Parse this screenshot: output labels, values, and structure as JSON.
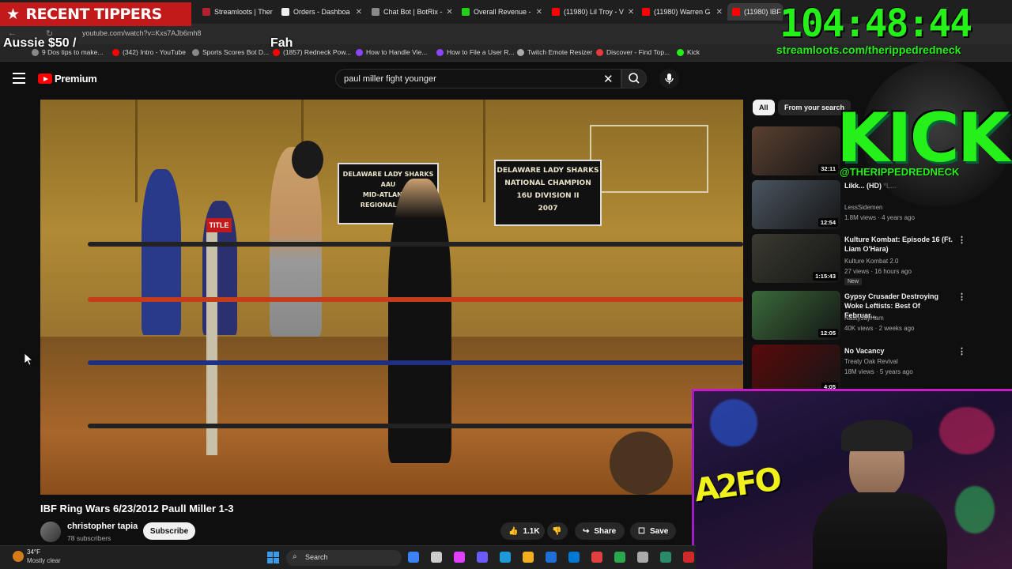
{
  "browser": {
    "tabs": [
      {
        "label": "RECENT TIPPERS",
        "fav": "#c21a1a"
      },
      {
        "label": "Streamloots | Ther",
        "fav": "#b32030"
      },
      {
        "label": "Orders - Dashboa",
        "fav": "#eeeeee"
      },
      {
        "label": "Chat Bot | BotRix -",
        "fav": "#8a8a8a"
      },
      {
        "label": "Overall Revenue -",
        "fav": "#25d01b"
      },
      {
        "label": "(11980) Lil Troy - V",
        "fav": "#ff0000"
      },
      {
        "label": "(11980) Warren G",
        "fav": "#ff0000"
      },
      {
        "label": "(11980) IBF R",
        "fav": "#ff0000"
      }
    ],
    "url": "youtube.com/watch?v=Kxs7AJb6mh8",
    "bookmarks": [
      {
        "label": "9 Dos tips to make...",
        "color": "#888888"
      },
      {
        "label": "(342) Intro - YouTube",
        "color": "#ff0000"
      },
      {
        "label": "Sports Scores Bot D...",
        "color": "#888888"
      },
      {
        "label": "(1857) Redneck Pow...",
        "color": "#ff0000"
      },
      {
        "label": "How to Handle Vie...",
        "color": "#8b44ff"
      },
      {
        "label": "How to File a User R...",
        "color": "#8b44ff"
      },
      {
        "label": "Twitch Emote Resizer",
        "color": "#aaaaaa"
      },
      {
        "label": "Discover - Find Top...",
        "color": "#e83a3a"
      },
      {
        "label": "Kick",
        "color": "#25f019"
      }
    ]
  },
  "overlay": {
    "recent_tippers": "RECENT TIPPERS",
    "tipper_name": "Aussie $50 /",
    "tipper_name_2": "Fah",
    "timer": "104:48:44",
    "streamloots_url": "streamloots.com/therippedredneck",
    "kick_text": "KICK",
    "kick_handle": "@THERIPPEDREDNECK",
    "cam_sign": "A2FO"
  },
  "youtube": {
    "logo_label": "Premium",
    "search_query": "paul miller fight younger",
    "video": {
      "banner_left_lines": [
        "DELAWARE LADY SHARKS AAU",
        "MID-ATLANTIC",
        "REGIONAL CH..."
      ],
      "banner_right_lines": [
        "DELAWARE LADY SHARKS",
        "NATIONAL CHAMPION",
        "16U DIVISION II",
        "2007"
      ],
      "corner_pad": "TITLE"
    },
    "title": "IBF Ring Wars 6/23/2012 Paull Miller 1-3",
    "channel": {
      "name": "christopher tapia",
      "subscribers": "78 subscribers"
    },
    "subscribe_label": "Subscribe",
    "likes": "1.1K",
    "share_label": "Share",
    "save_label": "Save",
    "chips": [
      "All",
      "From your search"
    ],
    "recommendations": [
      {
        "title": "",
        "channel": "",
        "meta": "",
        "duration": "32:11",
        "thumb": "#5a4030",
        "new": ""
      },
      {
        "title": "Likk... (HD) *L...",
        "channel": "LessSidemen",
        "meta": "1.8M views · 4 years ago",
        "duration": "12:54",
        "thumb": "#4a5560",
        "new": ""
      },
      {
        "title": "Kulture Kombat: Episode 16 (Ft. Liam O'Hara)",
        "channel": "Kulture Kombat 2.0",
        "meta": "27 views · 16 hours ago",
        "duration": "1:15:43",
        "thumb": "#3a3a30",
        "new": "New"
      },
      {
        "title": "Gypsy Crusader Destroying Woke Leftists: Best Of Februar...",
        "channel": "NastyJayHam",
        "meta": "40K views · 2 weeks ago",
        "duration": "12:05",
        "thumb": "#3a6a3a",
        "new": ""
      },
      {
        "title": "No Vacancy",
        "channel": "Treaty Oak Revival",
        "meta": "18M views · 5 years ago",
        "duration": "4:05",
        "thumb": "#5a0a0a",
        "new": ""
      }
    ]
  },
  "taskbar": {
    "temp": "34°F",
    "weather": "Mostly clear",
    "search_label": "Search",
    "icons": [
      "#3b82f6",
      "#cccccc",
      "#e040fb",
      "#6b5bff",
      "#1e9bd7",
      "#f2b01e",
      "#1f6fd6",
      "#0078d4",
      "#e04040",
      "#2aa84a",
      "#aaaaaa",
      "#2a8a6a",
      "#d02a2a"
    ]
  }
}
